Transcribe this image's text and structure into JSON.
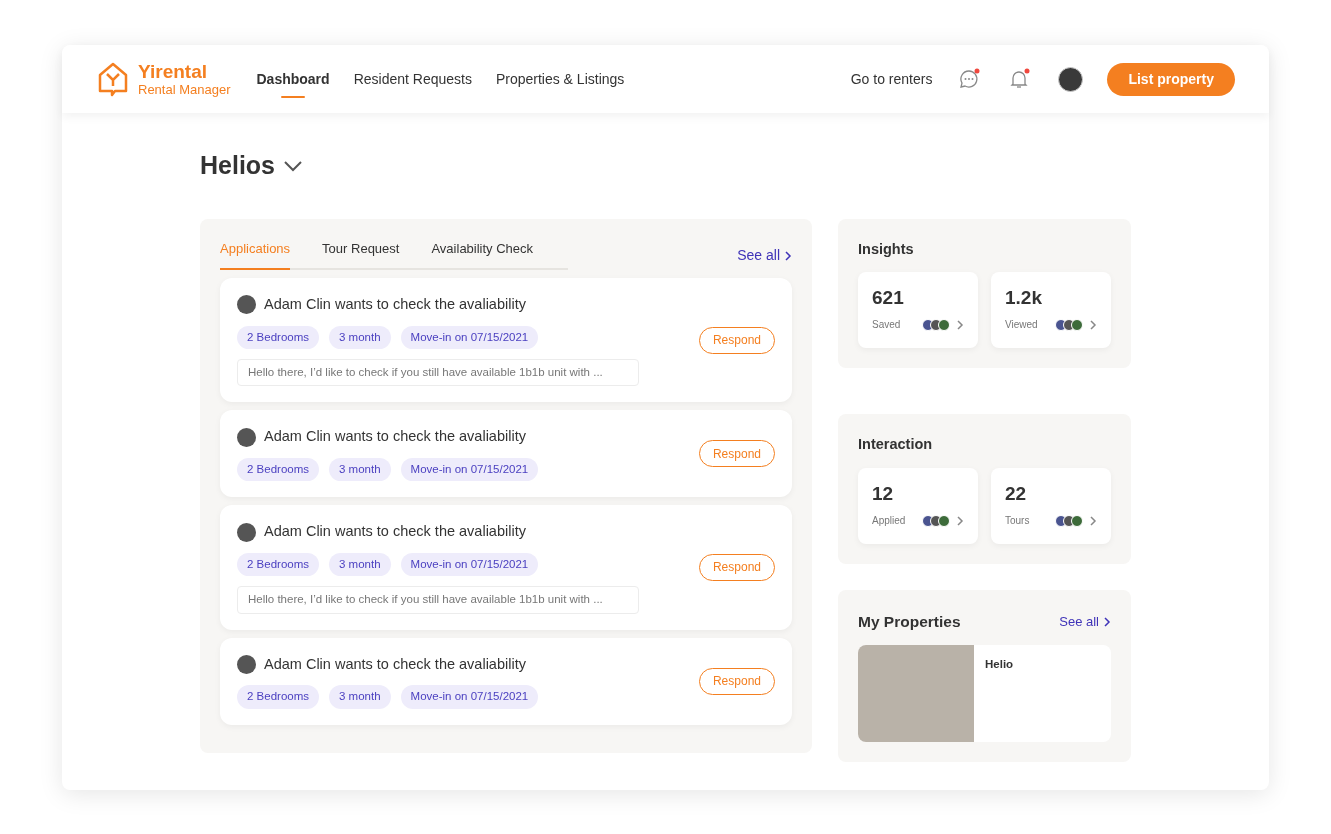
{
  "header": {
    "logo": {
      "title": "Yirental",
      "subtitle": "Rental Manager"
    },
    "nav": [
      {
        "label": "Dashboard",
        "selected": true
      },
      {
        "label": "Resident Requests",
        "selected": false
      },
      {
        "label": "Properties & Listings",
        "selected": false
      }
    ],
    "renters_link": "Go to renters",
    "messages": {
      "unread": true
    },
    "notifications": {
      "unread": true
    },
    "cta": "List property"
  },
  "page_title": "Helios",
  "requests": {
    "tabs": [
      {
        "label": "Applications",
        "selected": true
      },
      {
        "label": "Tour Request",
        "selected": false
      },
      {
        "label": "Availability Check",
        "selected": false
      }
    ],
    "see_all": "See all",
    "items": [
      {
        "title": "Adam Clin wants to check the avaliability",
        "tags": [
          "2 Bedrooms",
          "3 month",
          "Move-in on 07/15/2021"
        ],
        "message": "Hello there, I’d like to check if you still have available 1b1b unit with ...",
        "action": "Respond"
      },
      {
        "title": "Adam Clin wants to check the avaliability",
        "tags": [
          "2 Bedrooms",
          "3 month",
          "Move-in on 07/15/2021"
        ],
        "action": "Respond"
      },
      {
        "title": "Adam Clin wants to check the avaliability",
        "tags": [
          "2 Bedrooms",
          "3 month",
          "Move-in on 07/15/2021"
        ],
        "message": "Hello there, I’d like to check if you still have available 1b1b unit with ...",
        "action": "Respond"
      },
      {
        "title": "Adam Clin wants to check the avaliability",
        "tags": [
          "2 Bedrooms",
          "3 month",
          "Move-in on 07/15/2021"
        ],
        "action": "Respond"
      }
    ]
  },
  "insights": {
    "title": "Insights",
    "stats": [
      {
        "value": "621",
        "label": "Saved"
      },
      {
        "value": "1.2k",
        "label": "Viewed"
      }
    ]
  },
  "interaction": {
    "title": "Interaction",
    "stats": [
      {
        "value": "12",
        "label": "Applied"
      },
      {
        "value": "22",
        "label": "Tours"
      }
    ]
  },
  "properties": {
    "title": "My Properties",
    "see_all": "See all",
    "items": [
      {
        "name": "Helio"
      }
    ]
  }
}
